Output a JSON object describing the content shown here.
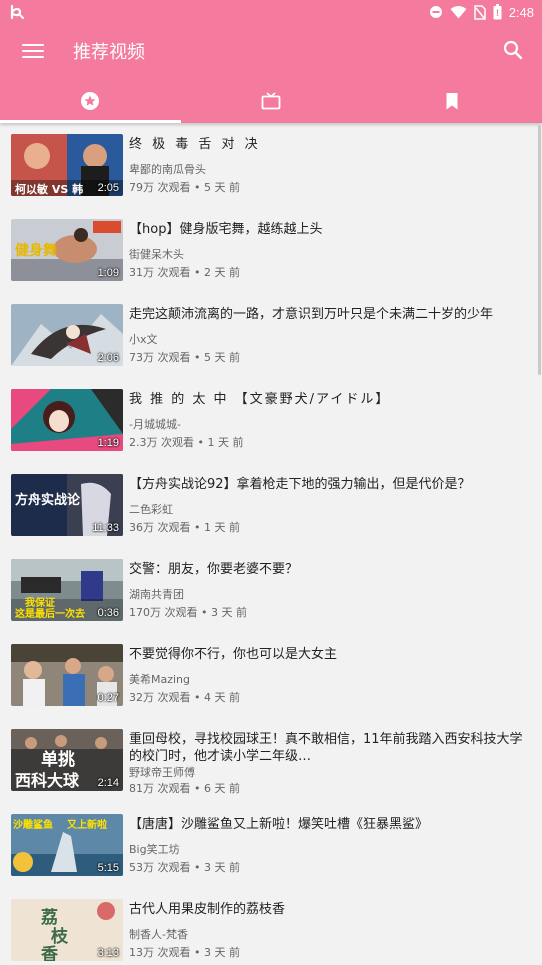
{
  "status_bar": {
    "time": "2:48",
    "icons": [
      "app-logo-icon",
      "dnd-icon",
      "wifi-icon",
      "no-sim-icon",
      "battery-icon"
    ]
  },
  "toolbar": {
    "title": "推荐视频",
    "menu_icon": "hamburger-menu-icon",
    "search_icon": "search-icon"
  },
  "tabs": [
    {
      "icon": "star-circle-icon",
      "active": true
    },
    {
      "icon": "tv-icon",
      "active": false
    },
    {
      "icon": "bookmark-icon",
      "active": false
    }
  ],
  "colors": {
    "primary": "#f47a9e",
    "background": "#f2f2f2",
    "title_text": "#222222",
    "meta_text": "#666666"
  },
  "videos": [
    {
      "title": "终 极 毒 舌 对 决",
      "author": "卑鄙的南瓜骨头",
      "meta": "79万 次观看 • 5 天 前",
      "duration": "2:05",
      "thumb_text": "柯以敏 VS 韩"
    },
    {
      "title": "【hop】健身版宅舞，越练越上头",
      "author": "街健呆木头",
      "meta": "31万 次观看 • 2 天 前",
      "duration": "1:09",
      "thumb_text": "健身舞"
    },
    {
      "title": "走完这颠沛流离的一路，才意识到万叶只是个未满二十岁的少年",
      "author": "小x文",
      "meta": "73万 次观看 • 5 天 前",
      "duration": "2:06",
      "thumb_text": ""
    },
    {
      "title": "我 推 的 太 中 【文豪野犬/アイドル】",
      "author": "-月城城城-",
      "meta": "2.3万 次观看 • 1 天 前",
      "duration": "1:19",
      "thumb_text": ""
    },
    {
      "title": "【方舟实战论92】拿着枪走下地的强力输出，但是代价是？",
      "author": "二色彩虹",
      "meta": "36万 次观看 • 1 天 前",
      "duration": "11:33",
      "thumb_text": "方舟实战论"
    },
    {
      "title": "交警：朋友，你要老婆不要？",
      "author": "湖南共青团",
      "meta": "170万 次观看 • 3 天 前",
      "duration": "0:36",
      "thumb_text": "我保证 这是最后一次去"
    },
    {
      "title": "不要觉得你不行，你也可以是大女主",
      "author": "美希Mazing",
      "meta": "32万 次观看 • 4 天 前",
      "duration": "0:27",
      "thumb_text": ""
    },
    {
      "title": "重回母校，寻找校园球王！真不敢相信，11年前我踏入西安科技大学的校门时，他才读小学二年级…",
      "author": "野球帝王师傅",
      "meta": "81万 次观看 • 6 天 前",
      "duration": "2:14",
      "thumb_text": "单挑 西科大球"
    },
    {
      "title": "【唐唐】沙雕鲨鱼又上新啦！爆笑吐槽《狂暴黑鲨》",
      "author": "Big笑工坊",
      "meta": "53万 次观看 • 3 天 前",
      "duration": "5:15",
      "thumb_text": "沙雕鲨鱼 又上新啦"
    },
    {
      "title": "古代人用果皮制作的荔枝香",
      "author": "制香人-梵香",
      "meta": "13万 次观看 • 3 天 前",
      "duration": "3:13",
      "thumb_text": "荔枝香"
    }
  ]
}
